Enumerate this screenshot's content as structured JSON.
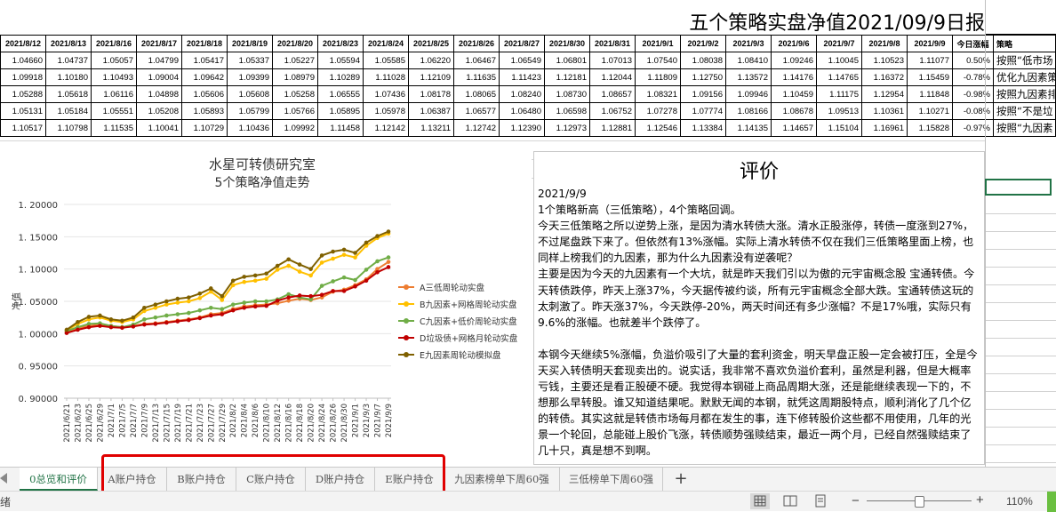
{
  "sheet_title": "五个策略实盘净值2021/09/9日报",
  "table": {
    "headers": [
      "2021/8/12",
      "2021/8/13",
      "2021/8/16",
      "2021/8/17",
      "2021/8/18",
      "2021/8/19",
      "2021/8/20",
      "2021/8/23",
      "2021/8/24",
      "2021/8/25",
      "2021/8/26",
      "2021/8/27",
      "2021/8/30",
      "2021/8/31",
      "2021/9/1",
      "2021/9/2",
      "2021/9/3",
      "2021/9/6",
      "2021/9/7",
      "2021/9/8",
      "2021/9/9",
      "今日涨幅",
      "策略"
    ],
    "rows": [
      [
        "1.04660",
        "1.04737",
        "1.05057",
        "1.04799",
        "1.05417",
        "1.05337",
        "1.05227",
        "1.05594",
        "1.05585",
        "1.06220",
        "1.06467",
        "1.06549",
        "1.06801",
        "1.07013",
        "1.07540",
        "1.08038",
        "1.08410",
        "1.09246",
        "1.10045",
        "1.10523",
        "1.11077",
        "0.50%",
        "按照“低市场"
      ],
      [
        "1.09918",
        "1.10180",
        "1.10493",
        "1.09004",
        "1.09642",
        "1.09399",
        "1.08979",
        "1.10289",
        "1.11028",
        "1.12109",
        "1.11635",
        "1.11423",
        "1.12181",
        "1.12044",
        "1.11809",
        "1.12750",
        "1.13572",
        "1.14176",
        "1.14765",
        "1.16372",
        "1.15459",
        "-0.78%",
        "优化九因素策"
      ],
      [
        "1.05288",
        "1.05618",
        "1.06116",
        "1.04898",
        "1.05606",
        "1.05608",
        "1.05258",
        "1.06555",
        "1.07436",
        "1.08178",
        "1.08065",
        "1.08240",
        "1.08730",
        "1.08657",
        "1.08321",
        "1.09156",
        "1.09946",
        "1.10459",
        "1.11175",
        "1.12954",
        "1.11848",
        "-0.98%",
        "按照九因素排"
      ],
      [
        "1.05131",
        "1.05184",
        "1.05551",
        "1.05208",
        "1.05893",
        "1.05799",
        "1.05766",
        "1.05895",
        "1.05978",
        "1.06387",
        "1.06577",
        "1.06480",
        "1.06598",
        "1.06752",
        "1.07278",
        "1.07774",
        "1.08166",
        "1.08678",
        "1.09513",
        "1.10361",
        "1.10271",
        "-0.08%",
        "按照“不是垃"
      ],
      [
        "1.10517",
        "1.10798",
        "1.11535",
        "1.10041",
        "1.10729",
        "1.10436",
        "1.09992",
        "1.11458",
        "1.12142",
        "1.13211",
        "1.12742",
        "1.12390",
        "1.12973",
        "1.12881",
        "1.12546",
        "1.13384",
        "1.14135",
        "1.14657",
        "1.15104",
        "1.16961",
        "1.15828",
        "-0.97%",
        "按照“九因素"
      ]
    ]
  },
  "chart_data": {
    "type": "line",
    "title": "水星可转债研究室",
    "subtitle": "5个策略净值走势",
    "ylabel": "净值",
    "xlabel": "",
    "ylim": [
      0.9,
      1.2
    ],
    "yticks": [
      "1. 20000",
      "1. 15000",
      "1. 10000",
      "1. 05000",
      "1. 00000",
      "0. 95000",
      "0. 90000"
    ],
    "x": [
      "2021/6/21",
      "2021/6/23",
      "2021/6/25",
      "2021/6/29",
      "2021/7/1",
      "2021/7/5",
      "2021/7/7",
      "2021/7/9",
      "2021/7/13",
      "2021/7/15",
      "2021/7/19",
      "2021/7/21",
      "2021/7/23",
      "2021/7/27",
      "2021/7/29",
      "2021/8/2",
      "2021/8/4",
      "2021/8/6",
      "2021/8/10",
      "2021/8/12",
      "2021/8/16",
      "2021/8/18",
      "2021/8/20",
      "2021/8/24",
      "2021/8/26",
      "2021/8/30",
      "2021/9/1",
      "2021/9/3",
      "2021/9/7",
      "2021/9/9"
    ],
    "series": [
      {
        "name": "A三低周轮动实盘",
        "color": "#ed7d31",
        "values": [
          1.003,
          1.008,
          1.012,
          1.014,
          1.012,
          1.01,
          1.012,
          1.015,
          1.016,
          1.018,
          1.02,
          1.022,
          1.025,
          1.03,
          1.032,
          1.038,
          1.042,
          1.044,
          1.045,
          1.047,
          1.051,
          1.054,
          1.052,
          1.056,
          1.065,
          1.068,
          1.075,
          1.084,
          1.1,
          1.111
        ]
      },
      {
        "name": "B九因素+网格周轮动实盘",
        "color": "#ffc000",
        "values": [
          1.005,
          1.015,
          1.022,
          1.025,
          1.02,
          1.018,
          1.022,
          1.035,
          1.04,
          1.045,
          1.048,
          1.05,
          1.055,
          1.065,
          1.052,
          1.075,
          1.08,
          1.082,
          1.085,
          1.099,
          1.105,
          1.096,
          1.09,
          1.11,
          1.116,
          1.122,
          1.118,
          1.136,
          1.148,
          1.155
        ]
      },
      {
        "name": "C九因素+低价周轮动实盘",
        "color": "#70ad47",
        "values": [
          1.004,
          1.01,
          1.015,
          1.016,
          1.012,
          1.01,
          1.014,
          1.022,
          1.025,
          1.028,
          1.03,
          1.032,
          1.036,
          1.04,
          1.038,
          1.045,
          1.048,
          1.05,
          1.05,
          1.053,
          1.061,
          1.056,
          1.053,
          1.074,
          1.081,
          1.087,
          1.083,
          1.099,
          1.112,
          1.118
        ]
      },
      {
        "name": "D垃圾债+网格月轮动实盘",
        "color": "#c00000",
        "values": [
          1.001,
          1.006,
          1.01,
          1.012,
          1.01,
          1.009,
          1.011,
          1.014,
          1.015,
          1.017,
          1.019,
          1.021,
          1.024,
          1.028,
          1.03,
          1.036,
          1.04,
          1.042,
          1.043,
          1.051,
          1.056,
          1.059,
          1.058,
          1.06,
          1.066,
          1.066,
          1.073,
          1.082,
          1.095,
          1.103
        ]
      },
      {
        "name": "E九因素周轮动模拟盘",
        "color": "#7f6000",
        "values": [
          1.006,
          1.018,
          1.026,
          1.028,
          1.022,
          1.02,
          1.025,
          1.04,
          1.045,
          1.05,
          1.054,
          1.056,
          1.062,
          1.07,
          1.058,
          1.082,
          1.088,
          1.09,
          1.093,
          1.105,
          1.115,
          1.107,
          1.1,
          1.121,
          1.127,
          1.13,
          1.125,
          1.141,
          1.151,
          1.158
        ]
      }
    ]
  },
  "comment": {
    "title": "评价",
    "paragraphs": [
      "2021/9/9",
      "1个策略新高（三低策略），4个策略回调。",
      "今天三低策略之所以逆势上涨，是因为清水转债大涨。清水正股涨停，转债一度涨到27%，不过尾盘跌下来了。但依然有13%涨幅。实际上清水转债不仅在我们三低策略里面上榜，也同样上榜我们的九因素，那为什么九因素没有逆袭呢？",
      "主要是因为今天的九因素有一个大坑，就是昨天我们引以为傲的元宇宙概念股 宝通转债。今天转债跌停，昨天上涨37%，今天据传被约谈，所有元宇宙概念全部大跌。宝通转债这玩的太刺激了。昨天涨37%，今天跌停-20%，两天时间还有多少涨幅？不是17%哦，实际只有9.6%的涨幅。也就差半个跌停了。",
      "",
      "本钢今天继续5%涨幅，负溢价吸引了大量的套利资金，明天早盘正股一定会被打压，全是今天买入转债明天套现卖出的。说实话，我非常不喜欢负溢价套利，虽然是利器，但是大概率亏钱，主要还是看正股硬不硬。我觉得本钢碰上商品周期大涨，还是能继续表现一下的，不想那么早转股。谁又知道结果呢。默默无闻的本钢，就凭这周期股特点，顺利消化了几个亿的转债。其实这就是转债市场每月都在发生的事，连下修转股价这些都不用使用，几年的光景一个轮回，总能碰上股价飞涨，转债顺势强赎结束，最近一两个月，已经自然强赎结束了几十只，真是想不到啊。"
    ]
  },
  "tabs": [
    {
      "label": "0总览和评价",
      "active": true
    },
    {
      "label": "A账户持仓"
    },
    {
      "label": "B账户持仓"
    },
    {
      "label": "C账户持仓"
    },
    {
      "label": "D账户持仓"
    },
    {
      "label": "E账户持仓"
    },
    {
      "label": "九因素榜单下周60强"
    },
    {
      "label": "三低榜单下周60强"
    }
  ],
  "add_sheet_label": "+",
  "status": {
    "ready_text": "绪",
    "zoom_level": "110%",
    "zoom_minus": "−",
    "zoom_plus": "+"
  }
}
